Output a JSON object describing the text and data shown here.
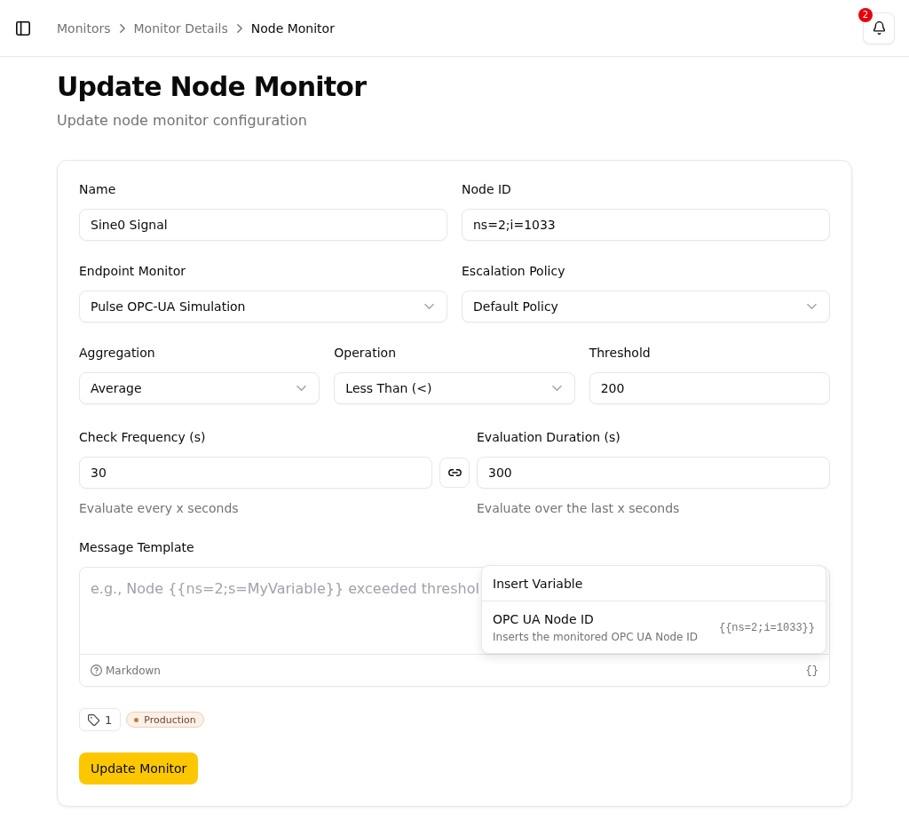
{
  "header": {
    "breadcrumbs": [
      {
        "label": "Monitors",
        "current": false
      },
      {
        "label": "Monitor Details",
        "current": false
      },
      {
        "label": "Node Monitor",
        "current": true
      }
    ],
    "notification_count": "2"
  },
  "page": {
    "title": "Update Node Monitor",
    "subtitle": "Update node monitor configuration"
  },
  "form": {
    "rows": [
      [
        {
          "label": "Name",
          "kind": "text",
          "value": "Sine0 Signal"
        },
        {
          "label": "Node ID",
          "kind": "text",
          "value": "ns=2;i=1033"
        }
      ],
      [
        {
          "label": "Endpoint Monitor",
          "kind": "select",
          "value": "Pulse OPC-UA Simulation"
        },
        {
          "label": "Escalation Policy",
          "kind": "select",
          "value": "Default Policy"
        }
      ],
      [
        {
          "label": "Aggregation",
          "kind": "select",
          "value": "Average"
        },
        {
          "label": "Operation",
          "kind": "select",
          "value": "Less Than (<)"
        },
        {
          "label": "Threshold",
          "kind": "text",
          "value": "200"
        }
      ]
    ],
    "timing": [
      {
        "label": "Check Frequency (s)",
        "value": "30",
        "help": "Evaluate every x seconds"
      },
      {
        "label": "Evaluation Duration (s)",
        "value": "300",
        "help": "Evaluate over the last x seconds"
      }
    ],
    "message_template": {
      "label": "Message Template",
      "placeholder": "e.g., Node {{ns=2;s=MyVariable}} exceeded threshol",
      "hint": "Markdown",
      "variables_button": "{}",
      "variable_menu": {
        "title": "Insert Variable",
        "items": [
          {
            "name": "OPC UA Node ID",
            "description": "Inserts the monitored OPC UA Node ID",
            "token": "{{ns=2;i=1033}}"
          }
        ]
      }
    },
    "tags": {
      "count": "1",
      "items": [
        {
          "label": "Production",
          "color": "#c97a3c"
        }
      ]
    },
    "submit": "Update Monitor"
  }
}
